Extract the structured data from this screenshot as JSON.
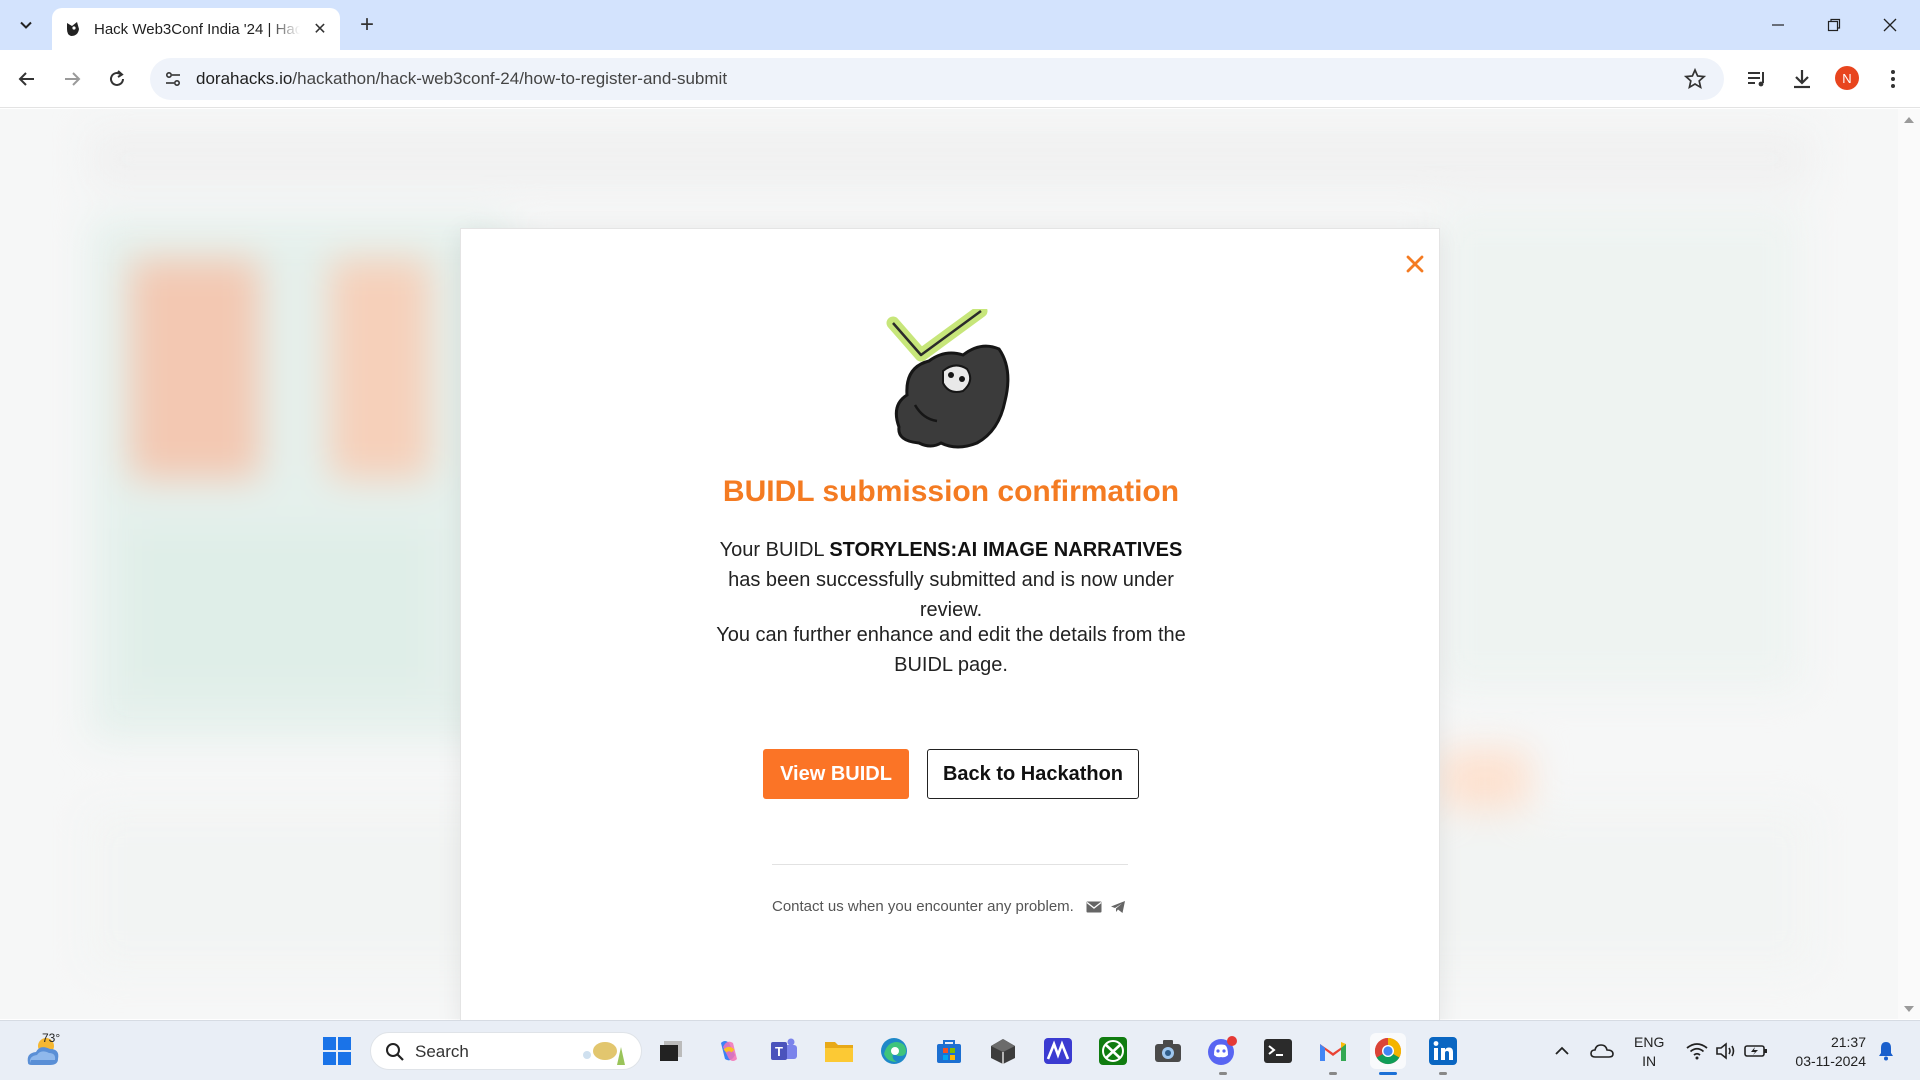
{
  "browser": {
    "tab_title": "Hack Web3Conf India '24 | Hack",
    "url_host": "dorahacks.io",
    "url_path": "/hackathon/hack-web3conf-24/how-to-register-and-submit",
    "profile_initial": "N"
  },
  "modal": {
    "title": "BUIDL submission confirmation",
    "msg1_prefix": "Your BUIDL ",
    "msg1_project": "STORYLENS:AI IMAGE NARRATIVES",
    "msg1_suffix": " has been successfully submitted and is now under review.",
    "msg2": "You can further enhance and edit the details from the BUIDL page.",
    "primary_button": "View BUIDL",
    "secondary_button": "Back to Hackathon",
    "contact_text": "Contact us when you encounter any problem."
  },
  "taskbar": {
    "weather_temp": "73°",
    "search_placeholder": "Search",
    "lang_line1": "ENG",
    "lang_line2": "IN",
    "time": "21:37",
    "date": "03-11-2024"
  },
  "colors": {
    "accent": "#fb7426",
    "title": "#f47b22",
    "tab_bar": "#d3e3fd"
  }
}
